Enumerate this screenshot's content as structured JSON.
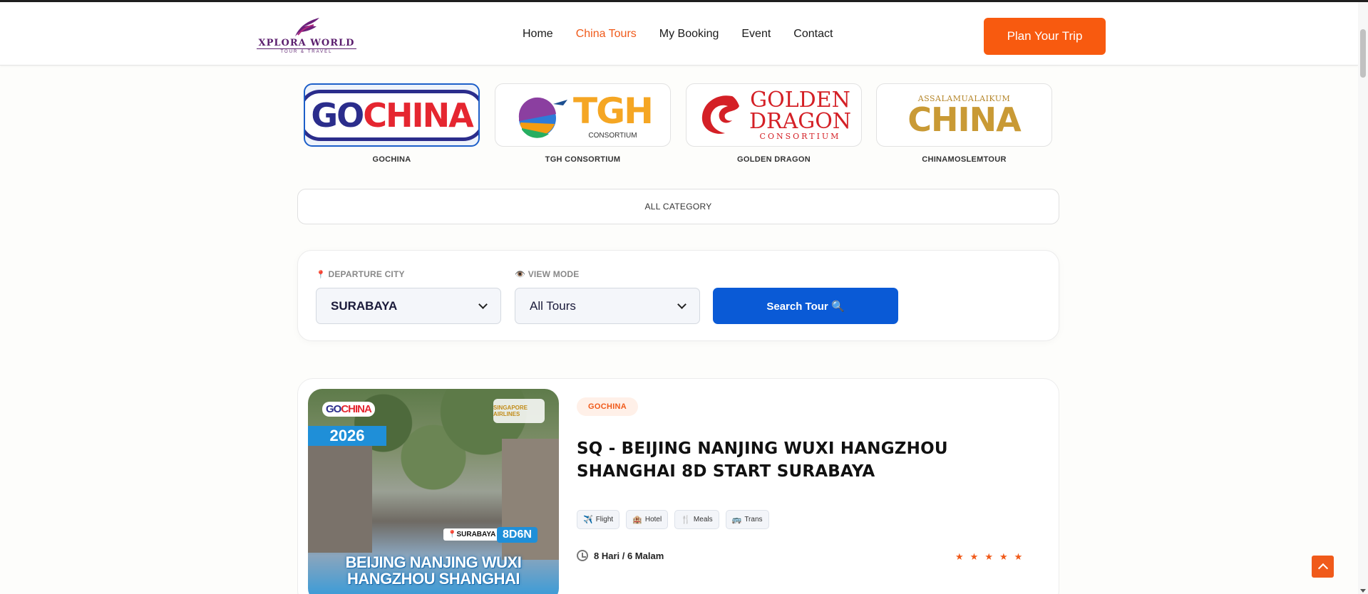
{
  "brand": {
    "name": "XPLORA WORLD",
    "tagline": "TOUR & TRAVEL"
  },
  "nav": [
    {
      "label": "Home",
      "active": false
    },
    {
      "label": "China Tours",
      "active": true
    },
    {
      "label": "My Booking",
      "active": false
    },
    {
      "label": "Event",
      "active": false
    },
    {
      "label": "Contact",
      "active": false
    }
  ],
  "cta": {
    "label": "Plan Your Trip"
  },
  "partners": [
    {
      "name": "GOCHINA",
      "logo_a": "GO",
      "logo_b": "CHINA",
      "selected": true
    },
    {
      "name": "TGH CONSORTIUM",
      "logo_a": "TGH",
      "logo_b": "CONSORTIUM",
      "selected": false
    },
    {
      "name": "GOLDEN DRAGON",
      "logo_a": "GOLDEN",
      "logo_b": "DRAGON",
      "logo_c": "CONSORTIUM",
      "selected": false
    },
    {
      "name": "CHINAMOSLEMTOUR",
      "logo_a": "ASSALAMUALAIKUM",
      "logo_b": "CHINA",
      "selected": false
    }
  ],
  "category": {
    "label": "ALL CATEGORY"
  },
  "search": {
    "departure_label": "DEPARTURE CITY",
    "departure_value": "SURABAYA",
    "view_label": "VIEW MODE",
    "view_value": "All Tours",
    "button_label": "Search Tour 🔍"
  },
  "tour": {
    "badge": "GOCHINA",
    "title": "SQ - BEIJING NANJING WUXI HANGZHOU SHANGHAI 8D START SURABAYA",
    "features": [
      {
        "icon": "✈️",
        "label": "Flight"
      },
      {
        "icon": "🏨",
        "label": "Hotel"
      },
      {
        "icon": "🍴",
        "label": "Meals"
      },
      {
        "icon": "🚌",
        "label": "Trans"
      }
    ],
    "duration": "8 Hari / 6 Malam",
    "rating": 5,
    "poster": {
      "logo_a": "GO",
      "logo_b": "CHINA",
      "year": "2026",
      "airline": "SINGAPORE AIRLINES",
      "city": "SURABAYA",
      "days": "8D6N",
      "line1": "BEIJING NANJING WUXI",
      "line2": "HANGZHOU SHANGHAI"
    }
  },
  "colors": {
    "accent": "#f05a1a",
    "primary": "#0a5ad6",
    "brand": "#5b1e6e"
  }
}
